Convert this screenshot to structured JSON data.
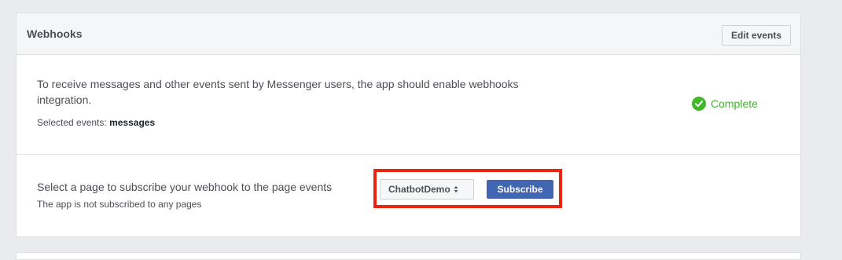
{
  "panel": {
    "title": "Webhooks",
    "edit_button_label": "Edit events"
  },
  "integration": {
    "description": "To receive messages and other events sent by Messenger users, the app should enable webhooks integration.",
    "selected_events_label": "Selected events:",
    "selected_events_value": "messages",
    "status": "Complete",
    "status_color": "#42b72a",
    "status_icon": "check-circle-icon"
  },
  "subscription": {
    "prompt": "Select a page to subscribe your webhook to the page events",
    "status": "The app is not subscribed to any pages",
    "page_select_value": "ChatbotDemo",
    "page_select_icon": "sort-arrows-icon",
    "subscribe_label": "Subscribe",
    "subscribe_color": "#4267b2",
    "highlight_color": "#e8250f"
  }
}
